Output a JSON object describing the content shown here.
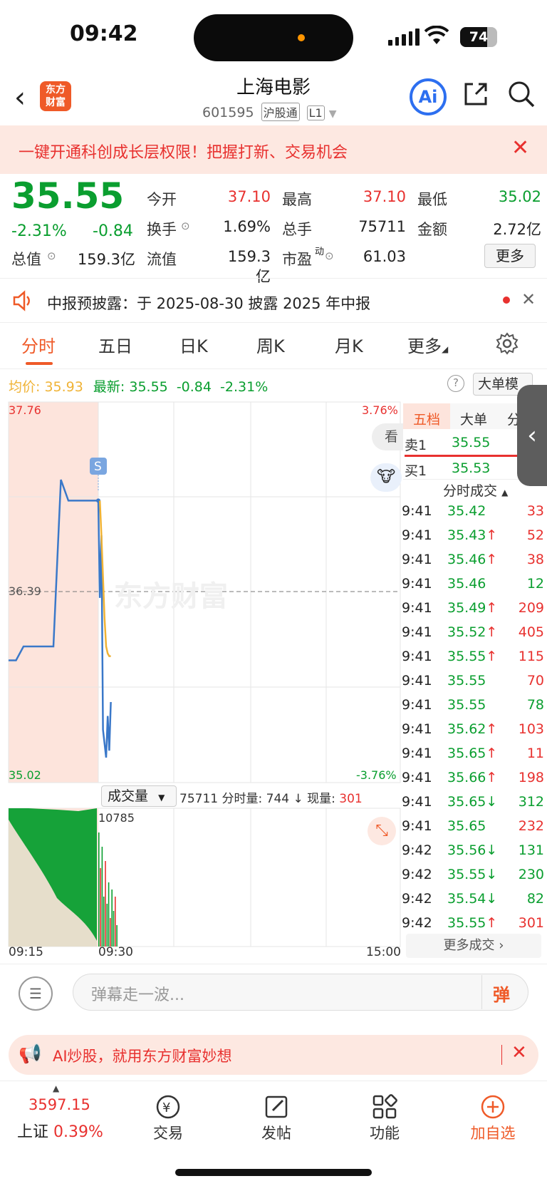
{
  "status_bar": {
    "time": "09:42",
    "battery": "74"
  },
  "header": {
    "logo_text": "东方财富",
    "title": "上海电影",
    "code": "601595",
    "tag1": "沪股通",
    "tag2": "L1",
    "ai_label": "Ai"
  },
  "promo_banner": {
    "text": "一键开通科创成长层权限！把握打新、交易机会"
  },
  "quote": {
    "price": "35.55",
    "change_pct": "-2.31%",
    "change": "-0.84",
    "fields": [
      {
        "label": "今开",
        "value": "37.10",
        "color": "red"
      },
      {
        "label": "最高",
        "value": "37.10",
        "color": "red"
      },
      {
        "label": "最低",
        "value": "35.02",
        "color": "green"
      },
      {
        "label": "换手",
        "value": "1.69%",
        "color": "black"
      },
      {
        "label": "总手",
        "value": "75711",
        "color": "black"
      },
      {
        "label": "金额",
        "value": "2.72亿",
        "color": "black"
      },
      {
        "label": "总值",
        "value": "159.3亿",
        "color": "black"
      },
      {
        "label": "流值",
        "value": "159.3亿",
        "color": "black"
      },
      {
        "label": "市盈",
        "value": "61.03",
        "color": "black"
      }
    ],
    "pe_sup": "动",
    "more_label": "更多"
  },
  "notice": {
    "text": "中报预披露：于 2025-08-30 披露 2025 年中报"
  },
  "tabs": [
    "分时",
    "五日",
    "日K",
    "周K",
    "月K",
    "更多"
  ],
  "chart_info": {
    "avg_label": "均价:",
    "avg_value": "35.93",
    "latest_label": "最新:",
    "latest_value": "35.55",
    "latest_change": "-0.84",
    "latest_pct": "-2.31%",
    "help": "?",
    "big_order_btn": "大单模"
  },
  "chart_labels": {
    "top_price": "37.76",
    "mid_price": "36.39",
    "bottom_price": "35.02",
    "top_pct": "3.76%",
    "bottom_pct": "-3.76%",
    "watermark": "东方财富",
    "signal": "S",
    "view_btn": "看"
  },
  "order_book": {
    "tabs": [
      "五档",
      "大单",
      "分"
    ],
    "sell1_label": "卖1",
    "sell1_price": "35.55",
    "buy1_label": "买1",
    "buy1_price": "35.53",
    "trades_title": "分时成交"
  },
  "trades": [
    {
      "t": "9:41",
      "p": "35.42",
      "arrow": "",
      "v": "33",
      "pc": "green",
      "vc": "red"
    },
    {
      "t": "9:41",
      "p": "35.43",
      "arrow": "↑",
      "v": "52",
      "pc": "green",
      "vc": "red"
    },
    {
      "t": "9:41",
      "p": "35.46",
      "arrow": "↑",
      "v": "38",
      "pc": "green",
      "vc": "red"
    },
    {
      "t": "9:41",
      "p": "35.46",
      "arrow": "",
      "v": "12",
      "pc": "green",
      "vc": "green"
    },
    {
      "t": "9:41",
      "p": "35.49",
      "arrow": "↑",
      "v": "209",
      "pc": "green",
      "vc": "red"
    },
    {
      "t": "9:41",
      "p": "35.52",
      "arrow": "↑",
      "v": "405",
      "pc": "green",
      "vc": "red"
    },
    {
      "t": "9:41",
      "p": "35.55",
      "arrow": "↑",
      "v": "115",
      "pc": "green",
      "vc": "red"
    },
    {
      "t": "9:41",
      "p": "35.55",
      "arrow": "",
      "v": "70",
      "pc": "green",
      "vc": "red"
    },
    {
      "t": "9:41",
      "p": "35.55",
      "arrow": "",
      "v": "78",
      "pc": "green",
      "vc": "green"
    },
    {
      "t": "9:41",
      "p": "35.62",
      "arrow": "↑",
      "v": "103",
      "pc": "green",
      "vc": "red"
    },
    {
      "t": "9:41",
      "p": "35.65",
      "arrow": "↑",
      "v": "11",
      "pc": "green",
      "vc": "red"
    },
    {
      "t": "9:41",
      "p": "35.66",
      "arrow": "↑",
      "v": "198",
      "pc": "green",
      "vc": "red"
    },
    {
      "t": "9:41",
      "p": "35.65",
      "arrow": "↓",
      "v": "312",
      "pc": "green",
      "vc": "green"
    },
    {
      "t": "9:41",
      "p": "35.65",
      "arrow": "",
      "v": "232",
      "pc": "green",
      "vc": "red"
    },
    {
      "t": "9:42",
      "p": "35.56",
      "arrow": "↓",
      "v": "131",
      "pc": "green",
      "vc": "green"
    },
    {
      "t": "9:42",
      "p": "35.55",
      "arrow": "↓",
      "v": "230",
      "pc": "green",
      "vc": "green"
    },
    {
      "t": "9:42",
      "p": "35.54",
      "arrow": "↓",
      "v": "82",
      "pc": "green",
      "vc": "green"
    },
    {
      "t": "9:42",
      "p": "35.55",
      "arrow": "↑",
      "v": "301",
      "pc": "green",
      "vc": "red"
    }
  ],
  "more_trades": "更多成交",
  "volume": {
    "selector": "成交量",
    "total": "75711",
    "period_label": "分时量:",
    "period_value": "744",
    "now_label": "现量:",
    "now_value": "301",
    "max_label": "10785"
  },
  "time_axis": {
    "start": "09:15",
    "mid": "09:30",
    "end": "15:00"
  },
  "comment": {
    "placeholder": "弹幕走一波...",
    "danmu": "弹"
  },
  "ai_banner": {
    "text": "AI炒股，就用东方财富妙想"
  },
  "bottom_nav": {
    "index_value": "3597.15",
    "index_name": "上证",
    "index_pct": "0.39%",
    "items": [
      {
        "label": "交易",
        "icon": "trade-icon"
      },
      {
        "label": "发帖",
        "icon": "post-icon"
      },
      {
        "label": "功能",
        "icon": "apps-icon"
      },
      {
        "label": "加自选",
        "icon": "add-watch-icon"
      }
    ]
  },
  "colors": {
    "up": "#e8312f",
    "down": "#0a9e2f",
    "accent": "#ef5a28",
    "price_line": "#3a78c9",
    "avg_line": "#f0b336"
  },
  "chart_data": {
    "type": "line",
    "ylim": [
      35.02,
      37.76
    ],
    "preclose": 36.39,
    "series": [
      {
        "name": "最新",
        "values": [
          35.9,
          35.9,
          36.0,
          36.0,
          36.0,
          36.0,
          36.0,
          37.2,
          37.05,
          37.05,
          37.05,
          37.05,
          37.05,
          36.35,
          36.8,
          35.4,
          35.3,
          35.2,
          35.5,
          35.25,
          35.6
        ]
      },
      {
        "name": "均价",
        "values": [
          null,
          null,
          null,
          null,
          null,
          null,
          null,
          null,
          null,
          null,
          null,
          null,
          null,
          37.05,
          36.8,
          36.5,
          36.2,
          36.0,
          35.95,
          35.93,
          35.93
        ]
      }
    ]
  }
}
